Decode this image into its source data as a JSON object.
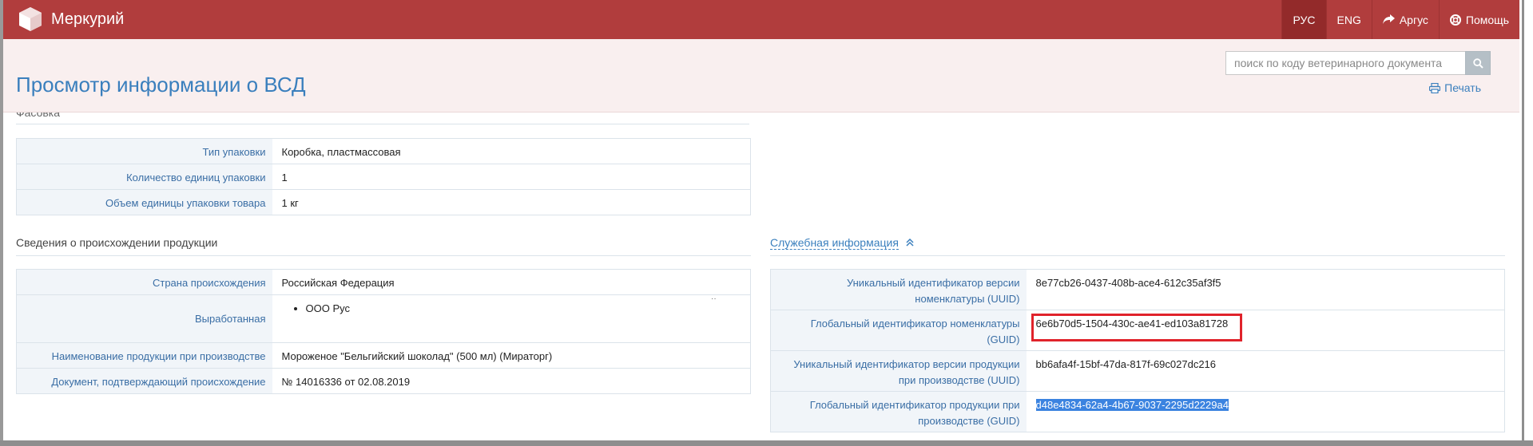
{
  "app": {
    "name": "Меркурий"
  },
  "nav": {
    "items": [
      {
        "label": "РУС",
        "active": true
      },
      {
        "label": "ENG",
        "active": false
      },
      {
        "label": "Аргус",
        "icon": "share-arrow-icon"
      },
      {
        "label": "Помощь",
        "icon": "lifebuoy-icon"
      }
    ]
  },
  "header": {
    "title": "Просмотр информации о ВСД",
    "search_placeholder": "поиск по коду ветеринарного документа",
    "print_label": "Печать"
  },
  "packaging": {
    "title_cut": "Фасовка",
    "rows": [
      {
        "label": "Тип упаковки",
        "value": "Коробка, пластмассовая"
      },
      {
        "label": "Количество единиц упаковки",
        "value": "1"
      },
      {
        "label": "Объем единицы упаковки товара",
        "value": "1 кг"
      }
    ]
  },
  "origin": {
    "title": "Сведения о происхождении продукции",
    "rows": [
      {
        "label": "Страна происхождения",
        "value": "Российская Федерация"
      },
      {
        "label": "Выработанная",
        "list": [
          "ООО Рус"
        ]
      },
      {
        "label": "Наименование продукции при производстве",
        "value": "Мороженое \"Бельгийский шоколад\" (500 мл) (Мираторг)"
      },
      {
        "label": "Документ, подтверждающий происхождение",
        "value": "№ 14016336 от 02.08.2019"
      }
    ]
  },
  "service": {
    "title": "Служебная информация",
    "rows": [
      {
        "label_1": "Уникальный идентификатор версии",
        "label_2": "номенклатуры (UUID)",
        "value": "8e77cb26-0437-408b-ace4-612c35af3f5"
      },
      {
        "label_1": "Глобальный идентификатор номенклатуры",
        "label_2": "(GUID)",
        "value": "6e6b70d5-1504-430c-ae41-ed103a81728"
      },
      {
        "label_1": "Уникальный идентификатор версии продукции",
        "label_2": "при производстве (UUID)",
        "value": "bb6afa4f-15bf-47da-817f-69c027dc216"
      },
      {
        "label_1": "Глобальный идентификатор продукции при",
        "label_2": "производстве (GUID)",
        "value": "d48e4834-62a4-4b67-9037-2295d2229a4"
      }
    ]
  },
  "colors": {
    "brand": "#b13d3d",
    "link": "#3a7fbd",
    "highlight_box": "#e0232b",
    "selection": "#3b83e0"
  }
}
